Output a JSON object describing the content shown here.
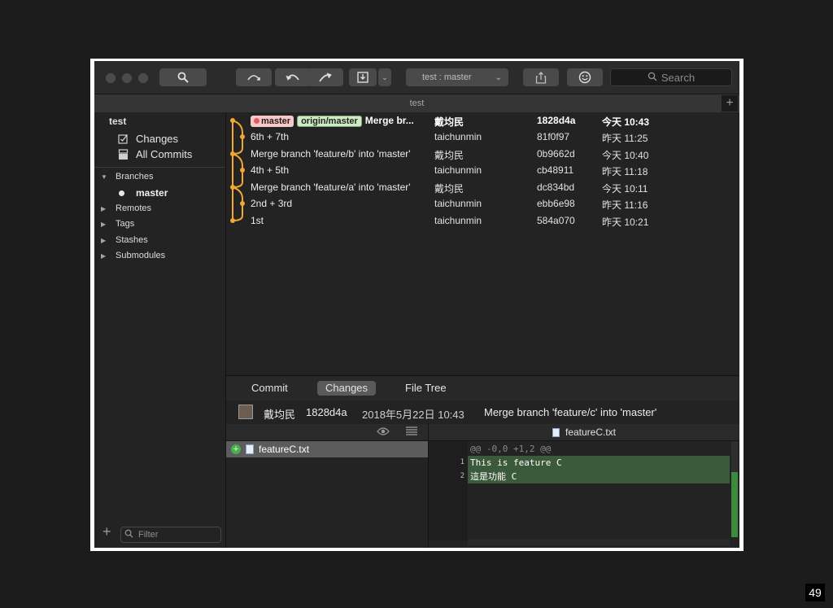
{
  "toolbar": {
    "branch_select": "test :  master",
    "search_placeholder": "Search"
  },
  "titlebar": {
    "title": "test",
    "plus": "+"
  },
  "sidebar": {
    "repo_name": "test",
    "workspace": [
      {
        "label": "Changes",
        "icon": "changes-icon"
      },
      {
        "label": "All Commits",
        "icon": "commits-icon"
      }
    ],
    "branches_header": "Branches",
    "current_branch": "master",
    "sections": [
      "Remotes",
      "Tags",
      "Stashes",
      "Submodules"
    ],
    "add": "+",
    "filter_placeholder": "Filter"
  },
  "commits": [
    {
      "tags": [
        "master",
        "origin/master"
      ],
      "message": "Merge br...",
      "author": "戴均民",
      "sha": "1828d4a",
      "date": "今天 10:43",
      "bold": true
    },
    {
      "tags": [],
      "message": "6th + 7th",
      "author": "taichunmin",
      "sha": "81f0f97",
      "date": "昨天 11:25"
    },
    {
      "tags": [],
      "message": "Merge branch 'feature/b' into 'master'",
      "author": "戴均民",
      "sha": "0b9662d",
      "date": "今天 10:40"
    },
    {
      "tags": [],
      "message": "4th + 5th",
      "author": "taichunmin",
      "sha": "cb48911",
      "date": "昨天 11:18"
    },
    {
      "tags": [],
      "message": "Merge branch 'feature/a' into 'master'",
      "author": "戴均民",
      "sha": "dc834bd",
      "date": "今天 10:11"
    },
    {
      "tags": [],
      "message": "2nd + 3rd",
      "author": "taichunmin",
      "sha": "ebb6e98",
      "date": "昨天 11:16"
    },
    {
      "tags": [],
      "message": "1st",
      "author": "taichunmin",
      "sha": "584a070",
      "date": "昨天 10:21"
    }
  ],
  "tabs": [
    {
      "label": "Commit",
      "active": false
    },
    {
      "label": "Changes",
      "active": true
    },
    {
      "label": "File Tree",
      "active": false
    }
  ],
  "commit_info": {
    "author": "戴均民",
    "sha": "1828d4a",
    "date": "2018年5月22日 10:43",
    "message": "Merge branch 'feature/c' into 'master'"
  },
  "files": [
    {
      "name": "featureC.txt",
      "status": "+"
    }
  ],
  "diff": {
    "file": "featureC.txt",
    "hunk": "@@ -0,0 +1,2 @@",
    "lines": [
      {
        "num": "1",
        "text": "This is feature C"
      },
      {
        "num": "2",
        "text": "這是功能 C"
      }
    ]
  },
  "page_number": "49",
  "colors": {
    "graph_line": "#f0a830",
    "tag_local": "#f6c9c9",
    "tag_remote": "#cfe9c9",
    "diff_added": "#3b5a3b"
  }
}
